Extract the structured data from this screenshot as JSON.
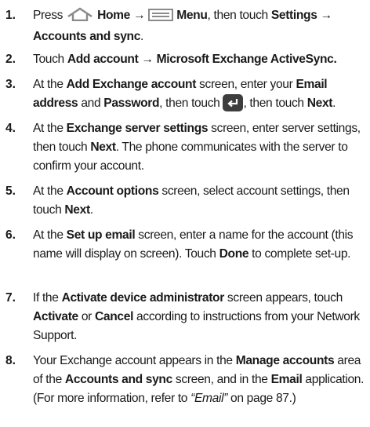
{
  "steps": [
    {
      "number": "1.",
      "parts": {
        "a": "Press ",
        "home": "Home",
        "arrow1": " → ",
        "menu": "Menu",
        "b": ", then touch ",
        "settings": "Settings →",
        "accounts_sync": "Accounts and sync",
        "end": "."
      }
    },
    {
      "number": "2.",
      "parts": {
        "a": "Touch ",
        "add_account": "Add account → Microsoft Exchange ActiveSync."
      }
    },
    {
      "number": "3.",
      "parts": {
        "a": "At the ",
        "screen": "Add Exchange account",
        "b": " screen, enter your ",
        "email": "Email address",
        "c": " and ",
        "password": "Password",
        "d": ", then touch ",
        "e": ", then touch ",
        "next": "Next",
        "end": "."
      },
      "enter_icon": "enter-key-icon"
    },
    {
      "number": "4.",
      "parts": {
        "a": "At the ",
        "screen": "Exchange server settings",
        "b": " screen, enter server settings, then touch ",
        "next": "Next",
        "c": ". The phone communicates with the server to confirm your account."
      }
    },
    {
      "number": "5.",
      "parts": {
        "a": "At the ",
        "screen": "Account options",
        "b": " screen, select account settings, then touch ",
        "next": "Next",
        "end": "."
      }
    },
    {
      "number": "6.",
      "parts": {
        "a": "At the ",
        "screen": "Set up email",
        "b": " screen, enter a name for the account (this name will display on screen). Touch ",
        "done": "Done",
        "c": " to complete set-up."
      }
    },
    {
      "number": "7.",
      "parts": {
        "a": "If the ",
        "screen": "Activate device administrator",
        "b": " screen appears, touch ",
        "activate": "Activate",
        "or": " or ",
        "cancel": "Cancel",
        "c": " according to instructions from your Network Support."
      }
    },
    {
      "number": "8.",
      "parts": {
        "a": "Your Exchange account appears in the ",
        "manage": "Manage accounts",
        "b": " area of the ",
        "accounts_sync": "Accounts and sync",
        "c": " screen, and in the ",
        "email": "Email",
        "d": " application. (For more information, refer to ",
        "ref": "“Email”",
        "e": " on page 87.)"
      }
    }
  ],
  "icons": {
    "home": "home-icon",
    "menu": "menu-icon",
    "enter": "enter-key-icon"
  },
  "colors": {
    "text": "#1a1a1a",
    "icon": "#8a8a8a",
    "enter_bg": "#3d3d3d"
  }
}
